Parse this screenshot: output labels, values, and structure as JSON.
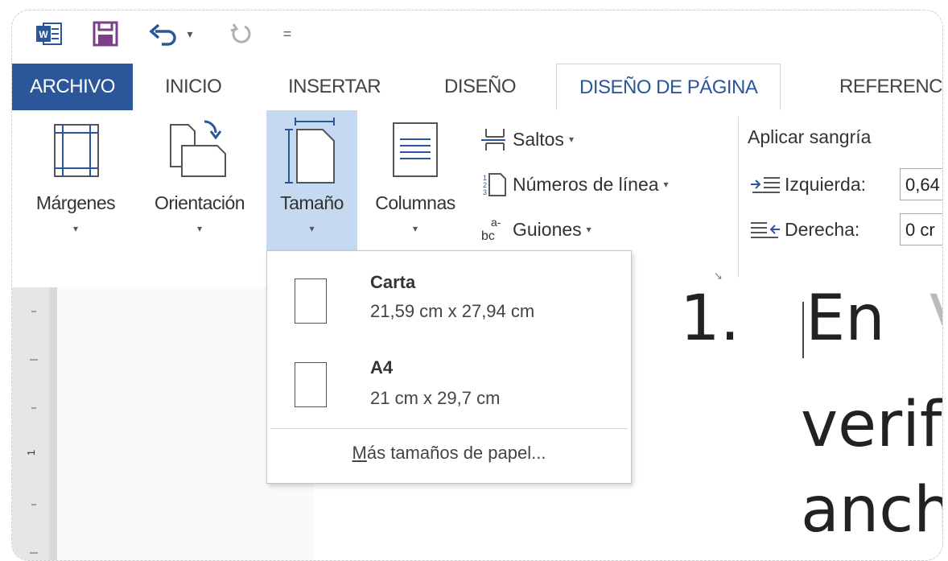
{
  "quick_access": {
    "word_icon": "word-app-icon",
    "save_icon": "save-icon",
    "undo_icon": "undo-icon",
    "undo_caret": "▾",
    "redo_icon": "redo-icon",
    "customize_icon": "customize-qat-icon",
    "customize_glyph": "="
  },
  "tabs": [
    "ARCHIVO",
    "INICIO",
    "INSERTAR",
    "DISEÑO",
    "DISEÑO DE PÁGINA",
    "REFERENC"
  ],
  "active_tab": "DISEÑO DE PÁGINA",
  "ribbon": {
    "margenes": "Márgenes",
    "orientacion": "Orientación",
    "tamano": "Tamaño",
    "columnas": "Columnas",
    "saltos": "Saltos",
    "numeros_linea": "Números de línea",
    "guiones": "Guiones",
    "aplicar_sangria": "Aplicar sangría",
    "izquierda": "Izquierda:",
    "izquierda_value": "0,64",
    "derecha": "Derecha:",
    "derecha_value": "0 cr",
    "caret": "▾",
    "launcher": "↘"
  },
  "dropdown": {
    "items": [
      {
        "name": "Carta",
        "size": "21,59 cm x 27,94 cm"
      },
      {
        "name": "A4",
        "size": "21 cm x 29,7 cm"
      }
    ],
    "more_prefix": "M",
    "more_rest": "ás tamaños de papel..."
  },
  "ruler_mark": "1",
  "document": {
    "list_number": "1.",
    "line1": "En",
    "line1_partial": "V",
    "line2": "verif",
    "line3": "anch"
  },
  "colors": {
    "word_blue": "#2b579a",
    "save_purple": "#7b3f8c",
    "selected_button": "#c5d9f1"
  }
}
